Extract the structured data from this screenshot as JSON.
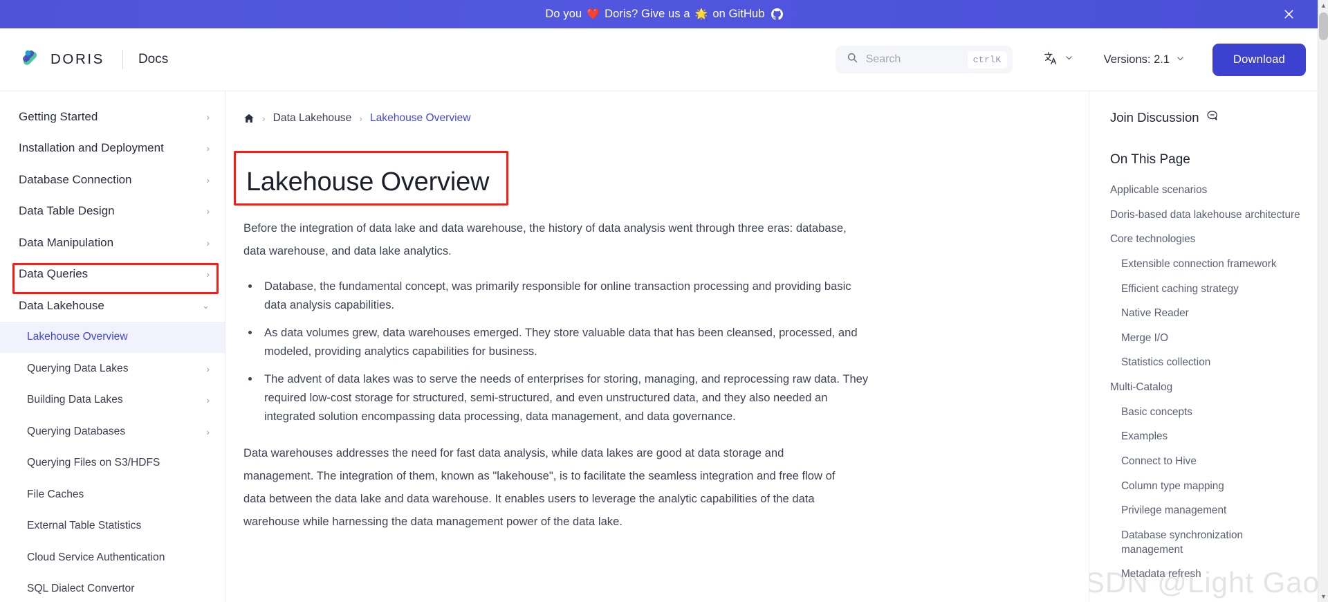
{
  "banner": {
    "prefix": "Do you",
    "heart": "❤️",
    "middle": "Doris? Give us a",
    "star": "🌟",
    "suffix": "on GitHub",
    "close_label": "✕",
    "bg_color": "#4f54d6"
  },
  "header": {
    "brand": "DORIS",
    "section": "Docs",
    "search": {
      "placeholder": "Search",
      "shortcut": "ctrlK"
    },
    "language_label": "文A",
    "versions_label": "Versions: 2.1",
    "download_label": "Download",
    "accent_color": "#3c42cf"
  },
  "sidebar": {
    "items": [
      {
        "label": "Getting Started",
        "caret": "›",
        "level": 1,
        "active": false
      },
      {
        "label": "Installation and Deployment",
        "caret": "›",
        "level": 1,
        "active": false
      },
      {
        "label": "Database Connection",
        "caret": "›",
        "level": 1,
        "active": false
      },
      {
        "label": "Data Table Design",
        "caret": "›",
        "level": 1,
        "active": false
      },
      {
        "label": "Data Manipulation",
        "caret": "›",
        "level": 1,
        "active": false
      },
      {
        "label": "Data Queries",
        "caret": "›",
        "level": 1,
        "active": false
      },
      {
        "label": "Data Lakehouse",
        "caret": "⌄",
        "level": 1,
        "active": false,
        "highlighted": true
      },
      {
        "label": "Lakehouse Overview",
        "caret": "",
        "level": 2,
        "active": true
      },
      {
        "label": "Querying Data Lakes",
        "caret": "›",
        "level": 2,
        "active": false
      },
      {
        "label": "Building Data Lakes",
        "caret": "›",
        "level": 2,
        "active": false
      },
      {
        "label": "Querying Databases",
        "caret": "›",
        "level": 2,
        "active": false
      },
      {
        "label": "Querying Files on S3/HDFS",
        "caret": "",
        "level": 2,
        "active": false
      },
      {
        "label": "File Caches",
        "caret": "",
        "level": 2,
        "active": false
      },
      {
        "label": "External Table Statistics",
        "caret": "",
        "level": 2,
        "active": false
      },
      {
        "label": "Cloud Service Authentication",
        "caret": "",
        "level": 2,
        "active": false
      },
      {
        "label": "SQL Dialect Convertor",
        "caret": "",
        "level": 2,
        "active": false
      }
    ]
  },
  "breadcrumb": {
    "home_icon": "home-icon",
    "items": [
      "Data Lakehouse",
      "Lakehouse Overview"
    ],
    "separator": "›"
  },
  "content": {
    "title": "Lakehouse Overview",
    "intro": "Before the integration of data lake and data warehouse, the history of data analysis went through three eras: database, data warehouse, and data lake analytics.",
    "bullets": [
      "Database, the fundamental concept, was primarily responsible for online transaction processing and providing basic data analysis capabilities.",
      "As data volumes grew, data warehouses emerged. They store valuable data that has been cleansed, processed, and modeled, providing analytics capabilities for business.",
      "The advent of data lakes was to serve the needs of enterprises for storing, managing, and reprocessing raw data. They required low-cost storage for structured, semi-structured, and even unstructured data, and they also needed an integrated solution encompassing data processing, data management, and data governance."
    ],
    "closing": "Data warehouses addresses the need for fast data analysis, while data lakes are good at data storage and management. The integration of them, known as \"lakehouse\", is to facilitate the seamless integration and free flow of data between the data lake and data warehouse. It enables users to leverage the analytic capabilities of the data warehouse while harnessing the data management power of the data lake."
  },
  "toc": {
    "join_label": "Join Discussion",
    "join_icon": "comment-icon",
    "heading": "On This Page",
    "items": [
      {
        "label": "Applicable scenarios",
        "level": 1
      },
      {
        "label": "Doris-based data lakehouse architecture",
        "level": 1
      },
      {
        "label": "Core technologies",
        "level": 1
      },
      {
        "label": "Extensible connection framework",
        "level": 2
      },
      {
        "label": "Efficient caching strategy",
        "level": 2
      },
      {
        "label": "Native Reader",
        "level": 2
      },
      {
        "label": "Merge I/O",
        "level": 2
      },
      {
        "label": "Statistics collection",
        "level": 2
      },
      {
        "label": "Multi-Catalog",
        "level": 1
      },
      {
        "label": "Basic concepts",
        "level": 2
      },
      {
        "label": "Examples",
        "level": 2
      },
      {
        "label": "Connect to Hive",
        "level": 2
      },
      {
        "label": "Column type mapping",
        "level": 2
      },
      {
        "label": "Privilege management",
        "level": 2
      },
      {
        "label": "Database synchronization management",
        "level": 2
      },
      {
        "label": "Metadata refresh",
        "level": 2
      }
    ]
  },
  "scrollbar": {
    "up_arrow": "▲",
    "down_arrow": "▼"
  },
  "watermark": {
    "text": "CSDN @Light Gao"
  }
}
